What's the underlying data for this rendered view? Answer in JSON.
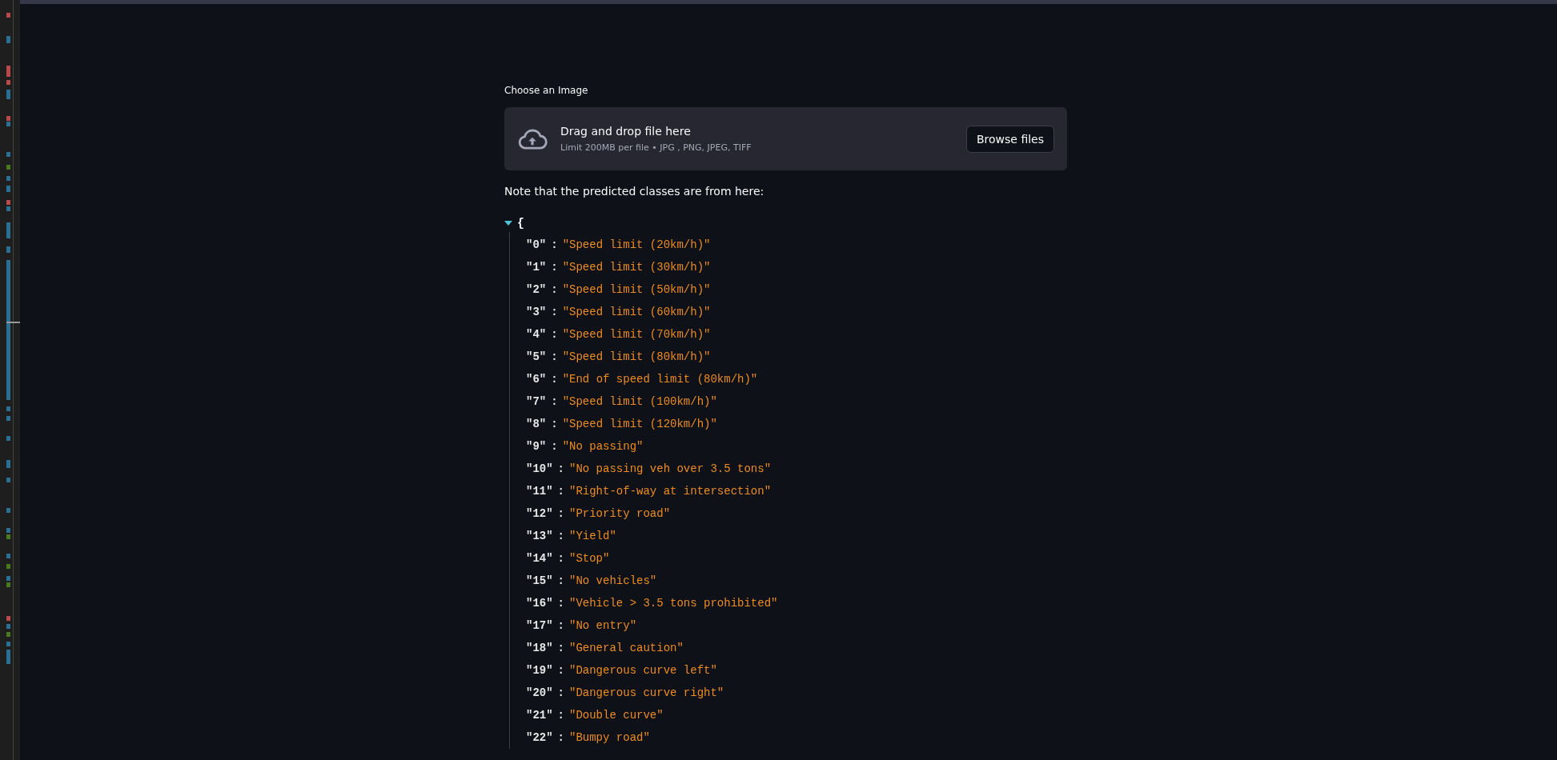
{
  "uploader": {
    "label": "Choose an Image",
    "title": "Drag and drop file here",
    "hint": "Limit 200MB per file • JPG , PNG, JPEG, TIFF",
    "button": "Browse files"
  },
  "note": "Note that the predicted classes are from here:",
  "json_view": {
    "expanded": true,
    "open_brace": "{",
    "entries": [
      {
        "key": "\"0\"",
        "separator": ":",
        "value": "\"Speed limit (20km/h)\""
      },
      {
        "key": "\"1\"",
        "separator": ":",
        "value": "\"Speed limit (30km/h)\""
      },
      {
        "key": "\"2\"",
        "separator": ":",
        "value": "\"Speed limit (50km/h)\""
      },
      {
        "key": "\"3\"",
        "separator": ":",
        "value": "\"Speed limit (60km/h)\""
      },
      {
        "key": "\"4\"",
        "separator": ":",
        "value": "\"Speed limit (70km/h)\""
      },
      {
        "key": "\"5\"",
        "separator": ":",
        "value": "\"Speed limit (80km/h)\""
      },
      {
        "key": "\"6\"",
        "separator": ":",
        "value": "\"End of speed limit (80km/h)\""
      },
      {
        "key": "\"7\"",
        "separator": ":",
        "value": "\"Speed limit (100km/h)\""
      },
      {
        "key": "\"8\"",
        "separator": ":",
        "value": "\"Speed limit (120km/h)\""
      },
      {
        "key": "\"9\"",
        "separator": ":",
        "value": "\"No passing\""
      },
      {
        "key": "\"10\"",
        "separator": ":",
        "value": "\"No passing veh over 3.5 tons\""
      },
      {
        "key": "\"11\"",
        "separator": ":",
        "value": "\"Right-of-way at intersection\""
      },
      {
        "key": "\"12\"",
        "separator": ":",
        "value": "\"Priority road\""
      },
      {
        "key": "\"13\"",
        "separator": ":",
        "value": "\"Yield\""
      },
      {
        "key": "\"14\"",
        "separator": ":",
        "value": "\"Stop\""
      },
      {
        "key": "\"15\"",
        "separator": ":",
        "value": "\"No vehicles\""
      },
      {
        "key": "\"16\"",
        "separator": ":",
        "value": "\"Vehicle > 3.5 tons prohibited\""
      },
      {
        "key": "\"17\"",
        "separator": ":",
        "value": "\"No entry\""
      },
      {
        "key": "\"18\"",
        "separator": ":",
        "value": "\"General caution\""
      },
      {
        "key": "\"19\"",
        "separator": ":",
        "value": "\"Dangerous curve left\""
      },
      {
        "key": "\"20\"",
        "separator": ":",
        "value": "\"Dangerous curve right\""
      },
      {
        "key": "\"21\"",
        "separator": ":",
        "value": "\"Double curve\""
      },
      {
        "key": "\"22\"",
        "separator": ":",
        "value": "\"Bumpy road\""
      }
    ]
  }
}
